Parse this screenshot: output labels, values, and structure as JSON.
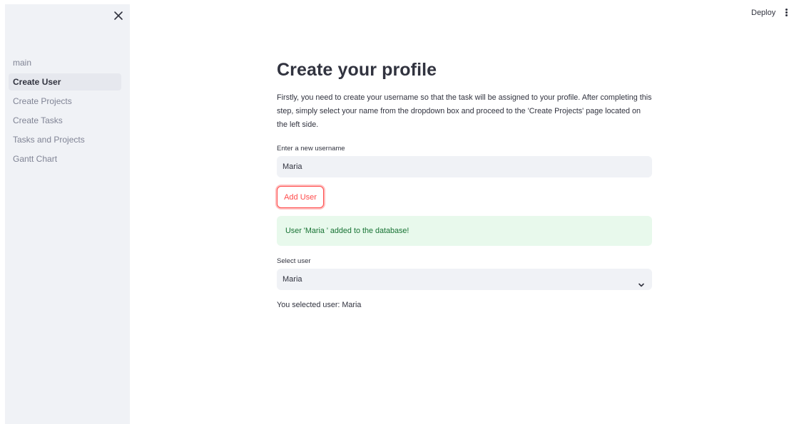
{
  "header": {
    "deploy_label": "Deploy",
    "menu_icon": "more-vertical-icon"
  },
  "sidebar": {
    "close_icon": "close-icon",
    "items": [
      {
        "label": "main",
        "active": false
      },
      {
        "label": "Create User",
        "active": true
      },
      {
        "label": "Create Projects",
        "active": false
      },
      {
        "label": "Create Tasks",
        "active": false
      },
      {
        "label": "Tasks and Projects",
        "active": false
      },
      {
        "label": "Gantt Chart",
        "active": false
      }
    ]
  },
  "main": {
    "title": "Create your profile",
    "intro": "Firstly, you need to create your username so that the task will be assigned to your profile. After completing this step, simply select your name from the dropdown box and proceed to the 'Create Projects' page located on the left side.",
    "username_field": {
      "label": "Enter a new username",
      "value": "Maria"
    },
    "add_button_label": "Add User",
    "success_message": "User 'Maria ' added to the database!",
    "select_user": {
      "label": "Select user",
      "selected": "Maria",
      "icon": "chevron-down-icon"
    },
    "result_text": "You selected user: Maria"
  },
  "colors": {
    "accent": "#ff4b4b",
    "sidebar_bg": "#f0f2f6",
    "success_bg": "#e8f9ec",
    "success_text": "#177233",
    "text": "#31333f"
  }
}
